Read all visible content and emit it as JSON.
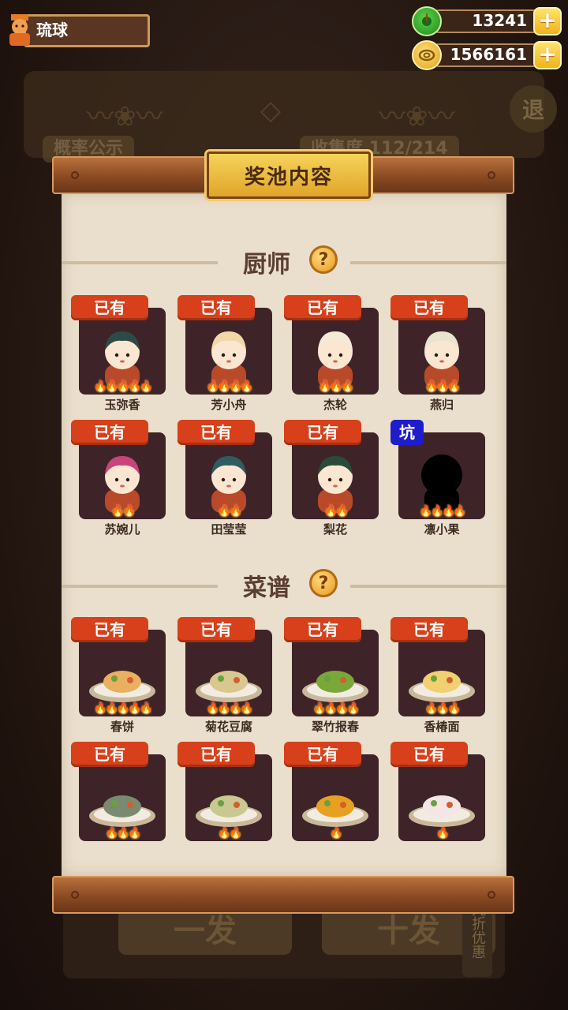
{
  "player": {
    "name": "琉球"
  },
  "currency": {
    "gems": "13241",
    "coins": "1566161",
    "plus_label": "+"
  },
  "background": {
    "tab_left": "概率公示",
    "tab_right": "收集度 112/214",
    "exit_label": "退",
    "btn_single": "一发",
    "btn_ten": "十发",
    "discount": "九折优惠"
  },
  "modal": {
    "title": "奖池内容",
    "chef_section": "厨师",
    "recipe_section": "菜谱",
    "help_label": "?",
    "chefs": [
      {
        "name": "玉弥香",
        "tag": "已有",
        "flames": "🔥🔥🔥🔥🔥",
        "color": "#2e4a48"
      },
      {
        "name": "芳小舟",
        "tag": "已有",
        "flames": "🔥🔥🔥🔥",
        "color": "#f2d8a8"
      },
      {
        "name": "杰轮",
        "tag": "已有",
        "flames": "🔥🔥🔥",
        "color": "#f4ead8"
      },
      {
        "name": "燕归",
        "tag": "已有",
        "flames": "🔥🔥🔥",
        "color": "#e9e4cf"
      },
      {
        "name": "苏婉儿",
        "tag": "已有",
        "flames": "🔥🔥",
        "color": "#c8447a"
      },
      {
        "name": "田莹莹",
        "tag": "已有",
        "flames": "🔥🔥",
        "color": "#2e5c60"
      },
      {
        "name": "梨花",
        "tag": "已有",
        "flames": "🔥🔥",
        "color": "#2a4a3a"
      },
      {
        "name": "凛小果",
        "tag": "坑",
        "flames": "🔥🔥🔥🔥",
        "color": "#000000"
      }
    ],
    "recipes": [
      {
        "name": "春饼",
        "tag": "已有",
        "flames": "🔥🔥🔥🔥🔥"
      },
      {
        "name": "菊花豆腐",
        "tag": "已有",
        "flames": "🔥🔥🔥🔥"
      },
      {
        "name": "翠竹报春",
        "tag": "已有",
        "flames": "🔥🔥🔥🔥"
      },
      {
        "name": "香椿面",
        "tag": "已有",
        "flames": "🔥🔥🔥"
      },
      {
        "name": "",
        "tag": "已有",
        "flames": "🔥🔥🔥"
      },
      {
        "name": "",
        "tag": "已有",
        "flames": "🔥🔥"
      },
      {
        "name": "",
        "tag": "已有",
        "flames": "🔥"
      },
      {
        "name": "",
        "tag": "已有",
        "flames": "🔥"
      }
    ]
  }
}
